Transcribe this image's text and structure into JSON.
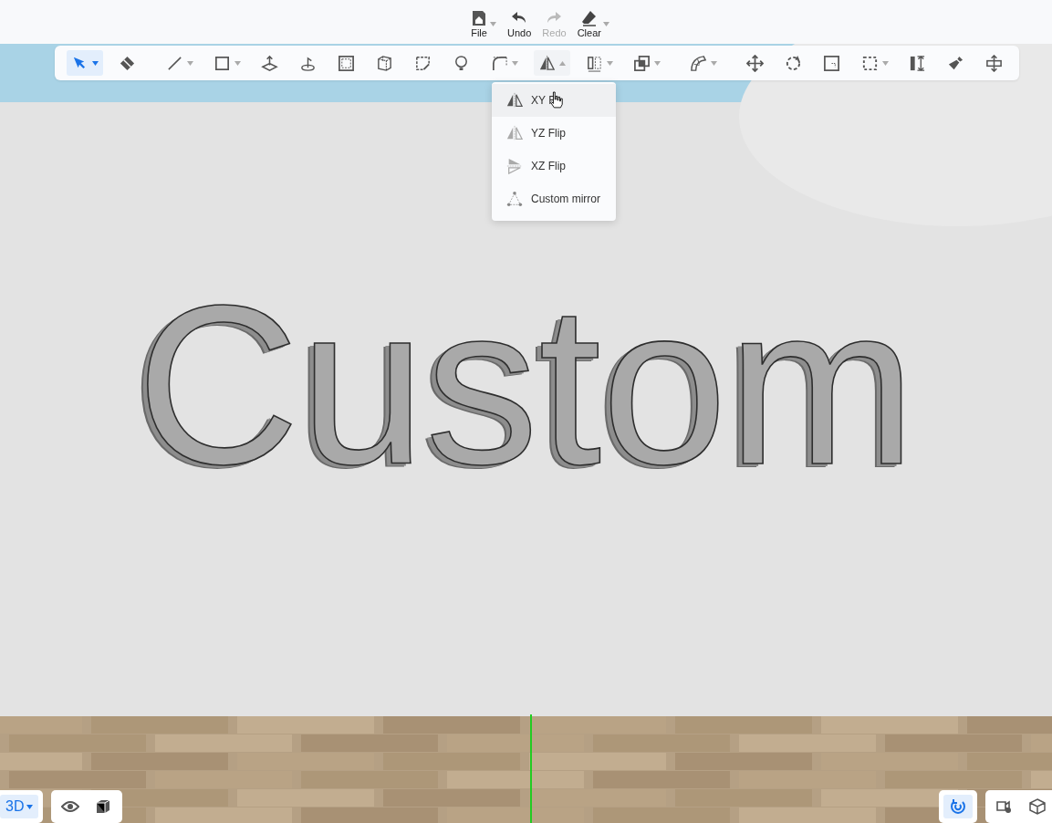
{
  "top_bar": {
    "actions": [
      {
        "label": "File",
        "dropdown": true,
        "disabled": false
      },
      {
        "label": "Undo",
        "dropdown": false,
        "disabled": false
      },
      {
        "label": "Redo",
        "dropdown": false,
        "disabled": true
      },
      {
        "label": "Clear",
        "dropdown": true,
        "disabled": false
      }
    ]
  },
  "toolbar": {
    "tools": [
      {
        "kind": "tool",
        "selected": true,
        "dropdown": true,
        "expanded": false
      },
      {
        "kind": "tool",
        "selected": false,
        "dropdown": false
      },
      {
        "kind": "separator"
      },
      {
        "kind": "tool",
        "selected": false,
        "dropdown": true,
        "expanded": false
      },
      {
        "kind": "tool",
        "selected": false,
        "dropdown": true,
        "expanded": false
      },
      {
        "kind": "tool",
        "selected": false,
        "dropdown": false
      },
      {
        "kind": "tool",
        "selected": false,
        "dropdown": false
      },
      {
        "kind": "tool",
        "selected": false,
        "dropdown": false
      },
      {
        "kind": "tool",
        "selected": false,
        "dropdown": false
      },
      {
        "kind": "tool",
        "selected": false,
        "dropdown": false
      },
      {
        "kind": "tool",
        "selected": false,
        "dropdown": false
      },
      {
        "kind": "tool",
        "selected": false,
        "dropdown": true,
        "expanded": false
      },
      {
        "kind": "tool",
        "selected": false,
        "dropdown": true,
        "expanded": true
      },
      {
        "kind": "tool",
        "selected": false,
        "dropdown": true,
        "expanded": false
      },
      {
        "kind": "tool",
        "selected": false,
        "dropdown": true,
        "expanded": false
      },
      {
        "kind": "separator"
      },
      {
        "kind": "tool",
        "selected": false,
        "dropdown": true,
        "expanded": false
      },
      {
        "kind": "separator"
      },
      {
        "kind": "tool",
        "selected": false,
        "dropdown": false
      },
      {
        "kind": "tool",
        "selected": false,
        "dropdown": false
      },
      {
        "kind": "tool",
        "selected": false,
        "dropdown": false
      },
      {
        "kind": "tool",
        "selected": false,
        "dropdown": true,
        "expanded": false
      },
      {
        "kind": "tool",
        "selected": false,
        "dropdown": false
      },
      {
        "kind": "tool",
        "selected": false,
        "dropdown": false
      },
      {
        "kind": "tool",
        "selected": false,
        "dropdown": false
      }
    ]
  },
  "mirror_menu": {
    "items": [
      {
        "label": "XY F",
        "selected": true
      },
      {
        "label": "YZ Flip",
        "selected": false
      },
      {
        "label": "XZ Flip",
        "selected": false
      },
      {
        "label": "Custom mirror",
        "selected": false
      }
    ]
  },
  "scene": {
    "model_text": "Custom"
  },
  "view_controls": {
    "view_mode": {
      "label": "3D",
      "selected": true
    },
    "buttons": [
      {
        "selected": false
      },
      {
        "selected": false
      }
    ]
  },
  "right_controls": {
    "buttons": [
      {
        "selected": true
      },
      {
        "selected": false
      },
      {
        "selected": false
      }
    ]
  }
}
